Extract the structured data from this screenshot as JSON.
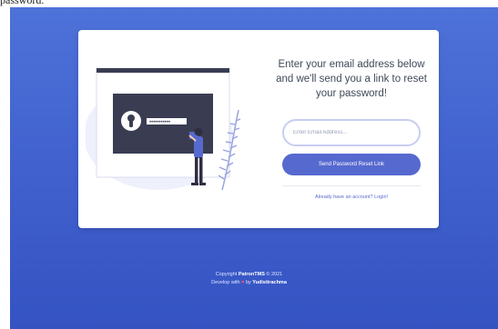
{
  "header_fragment": "password.",
  "card": {
    "heading": "Enter your email address below and we'll send you a link to reset your password!",
    "email_placeholder": "Enter Email Address...",
    "submit_label": "Send Password Reset Link",
    "login_link": "Already have an account? Login!"
  },
  "illustration": {
    "password_mask": "•••••••••••",
    "accent_color": "#5669cf",
    "icon": "lock-keyhole-icon"
  },
  "footer": {
    "copyright_prefix": "Copyright",
    "brand": "PatronTMS",
    "year": "© 2021",
    "develop_prefix": "Develop with",
    "heart_icon": "heart-icon",
    "by": "by",
    "author": "Yudistirachma"
  },
  "colors": {
    "background": "#4263cf",
    "primary": "#5669cf",
    "card": "#ffffff"
  }
}
